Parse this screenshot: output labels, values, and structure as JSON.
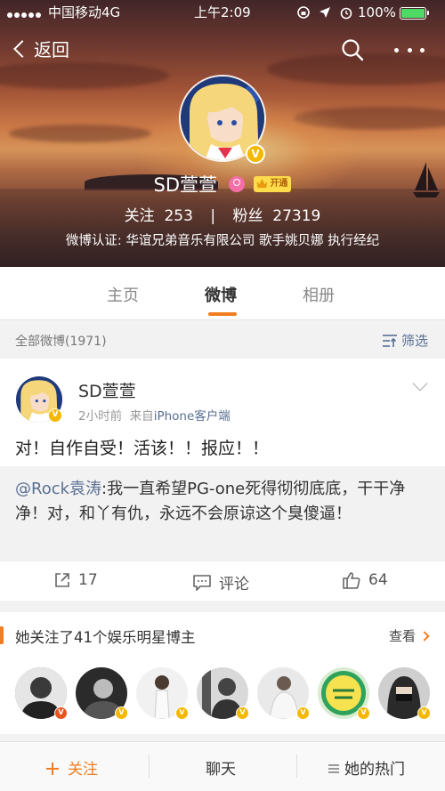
{
  "status_bar": {
    "carrier": "中国移动",
    "network": "4G",
    "time": "上午2:09",
    "battery_percent": "100%",
    "battery_level": 1.0
  },
  "nav": {
    "back_label": "返回",
    "search_icon": "search-icon",
    "more_icon": "more-icon"
  },
  "profile": {
    "name": "SD萱萱",
    "vip_label": "开通",
    "following_label": "关注",
    "following_count": "253",
    "followers_label": "粉丝",
    "followers_count": "27319",
    "stats_separator": "|",
    "verification": "微博认证: 华谊兄弟音乐有限公司 歌手姚贝娜 执行经纪"
  },
  "tabs": [
    {
      "label": "主页",
      "active": false
    },
    {
      "label": "微博",
      "active": true
    },
    {
      "label": "相册",
      "active": false
    }
  ],
  "filter": {
    "count_label": "全部微博(1971)",
    "filter_label": "筛选"
  },
  "post": {
    "user": "SD萱萱",
    "time": "2小时前",
    "source_prefix": "来自",
    "source_client": "iPhone客户端",
    "text": "对！自作自受！活该！！报应！！",
    "repost_mention": "@Rock袁涛",
    "repost_text": ":我一直希望PG-one死得彻彻底底，干干净净！对，和丫有仇，永远不会原谅这个臭傻逼！",
    "reposts": "17",
    "comments_label": "评论",
    "likes": "64"
  },
  "recommendation": {
    "title": "她关注了41个娱乐明星博主",
    "more_label": "查看",
    "badge_colors": [
      "#e8541e",
      "#f5b800",
      "#f5b800",
      "#f5b800",
      "#f5b800",
      "#f5b800",
      "#f5b800"
    ]
  },
  "bottom_bar": {
    "follow_label": "关注",
    "chat_label": "聊天",
    "hot_label": "她的热门"
  },
  "colors": {
    "accent": "#f27d20",
    "link": "#5a6f94",
    "verified_gold": "#f5b800"
  }
}
